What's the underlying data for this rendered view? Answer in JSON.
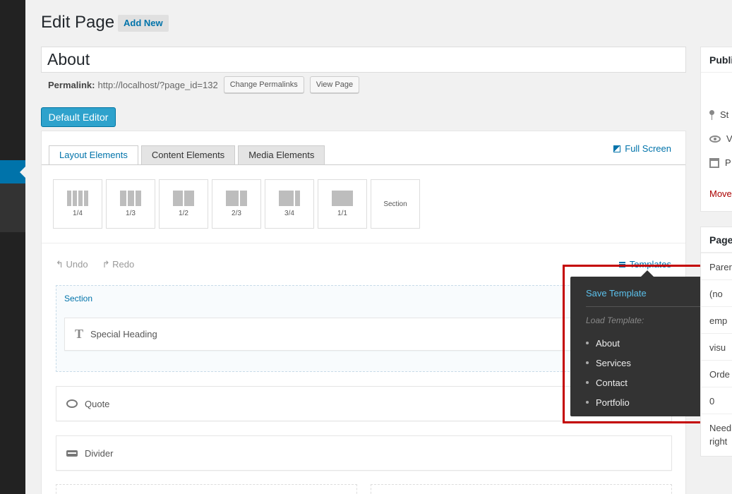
{
  "header": {
    "title": "Edit Page",
    "add_new": "Add New"
  },
  "post": {
    "title": "About",
    "permalink_label": "Permalink:",
    "permalink_url": "http://localhost/?page_id=132",
    "change_permalinks": "Change Permalinks",
    "view_page": "View Page"
  },
  "editor_toggle": "Default Editor",
  "builder": {
    "tabs": [
      "Layout Elements",
      "Content Elements",
      "Media Elements"
    ],
    "full_screen": "Full Screen",
    "layout_items": [
      "1/4",
      "1/3",
      "1/2",
      "2/3",
      "3/4",
      "1/1",
      "Section"
    ],
    "undo": "Undo",
    "redo": "Redo",
    "templates": "Templates",
    "section_label": "Section",
    "elements": [
      "Special Heading",
      "Quote",
      "Divider"
    ]
  },
  "templates_popover": {
    "save": "Save Template",
    "load_label": "Load Template:",
    "items": [
      "About",
      "Services",
      "Contact",
      "Portfolio"
    ]
  },
  "sidebar": {
    "publish": {
      "title": "Publi",
      "rows": [
        "St",
        "V",
        "P"
      ],
      "move": "Move"
    },
    "page_attributes": {
      "title": "Page",
      "rows": [
        "Parer",
        "(no",
        "emp",
        "visu",
        "Orde",
        "0",
        "Need",
        "right"
      ]
    }
  },
  "colors": {
    "accent": "#0073aa",
    "button_primary": "#2ea2cc",
    "highlight": "#c40000",
    "popover_bg": "#333333"
  }
}
